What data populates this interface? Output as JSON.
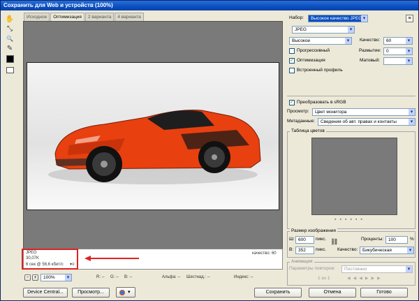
{
  "window": {
    "title": "Сохранить для Web и устройств (100%)"
  },
  "tools": {
    "hand": "✋",
    "slice": "⤡",
    "zoom": "🔍",
    "eyedropper": "✎"
  },
  "tabs": [
    "Исходное",
    "Оптимизация",
    "2 варианта",
    "4 варианта"
  ],
  "info": {
    "format": "JPEG",
    "size": "30,07K",
    "speed": "6 сек @ 56,6 кбит/с",
    "menu": "▾≡",
    "quality": "качество: 60"
  },
  "status": {
    "zoom": "100%",
    "r": "R: --",
    "g": "G: --",
    "b": "B: --",
    "alpha": "Альфа: --",
    "hex": "Шестнад.: --",
    "index": "Индекс: --"
  },
  "buttons": {
    "device_central": "Device Central...",
    "preview": "Просмотр...",
    "save": "Сохранить",
    "cancel": "Отмена",
    "done": "Готово"
  },
  "settings": {
    "preset_label": "Набор:",
    "preset_value": "Высокое качество JPEG",
    "format_value": "JPEG",
    "compression_value": "Высокое",
    "quality_label": "Качество:",
    "quality_value": "60",
    "progressive_label": "Прогрессивный",
    "blur_label": "Размытие:",
    "blur_value": "0",
    "optimized_label": "Оптимизация",
    "matte_label": "Матовый:",
    "embed_profile_label": "Встроенный профиль",
    "convert_srgb_label": "Преобразовать в sRGB",
    "preview_label": "Просмотр:",
    "preview_value": "Цвет монитора",
    "metadata_label": "Метаданные:",
    "metadata_value": "Сведения об авт. правах и контакты",
    "color_table_label": "Таблица цветов",
    "image_size_label": "Размер изображения",
    "width_label": "Ш:",
    "width_value": "600",
    "height_label": "В:",
    "height_value": "352",
    "unit_label": "пикс.",
    "percent_label": "Проценты:",
    "percent_value": "100",
    "percent_sign": "%",
    "quality_method_label": "Качество:",
    "quality_method_value": "Бикубическая",
    "animation_label": "Анимация",
    "loop_label": "Параметры повторов:",
    "loop_value": "Постоянно",
    "frame_counter": "1 из 1"
  },
  "colors": {
    "title_blue": "#0a4fc0",
    "car_orange": "#e8400f",
    "highlight": "#e02020"
  }
}
